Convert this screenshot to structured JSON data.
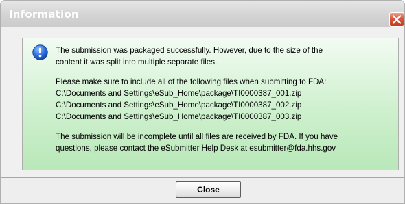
{
  "window": {
    "title": "Information"
  },
  "icons": {
    "close_titlebar": "close-icon",
    "message_icon": "info-icon"
  },
  "message": {
    "intro_line_1": "The submission was packaged successfully. However, due to the size of the",
    "intro_line_2": "content it was split into multiple separate files.",
    "instruction": "Please make sure to include all of the following files when submitting to FDA:",
    "files": [
      "C:\\Documents and Settings\\eSub_Home\\package\\TI0000387_001.zip",
      "C:\\Documents and Settings\\eSub_Home\\package\\TI0000387_002.zip",
      "C:\\Documents and Settings\\eSub_Home\\package\\TI0000387_003.zip"
    ],
    "closing_line_1": "The submission will be incomplete until all files are received by FDA. If you have",
    "closing_line_2": "questions, please contact the eSubmitter Help Desk at esubmitter@fda.hhs.gov"
  },
  "footer": {
    "close_label": "Close"
  },
  "colors": {
    "panel_top": "#f2fbf2",
    "panel_bottom": "#b9e8b9",
    "close_button_red": "#d7563a",
    "info_blue": "#1f5fd6"
  }
}
